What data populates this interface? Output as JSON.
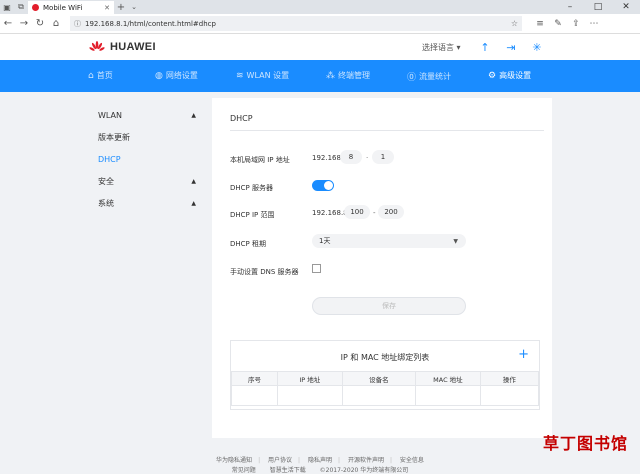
{
  "browser": {
    "tab_title": "Mobile WiFi",
    "url": "192.168.8.1/html/content.html#dhcp"
  },
  "header": {
    "brand": "HUAWEI",
    "language": "选择语言"
  },
  "main_nav": [
    {
      "label": "首页",
      "icon": "home-icon",
      "active": false
    },
    {
      "label": "网络设置",
      "icon": "globe-icon",
      "active": false
    },
    {
      "label": "WLAN 设置",
      "icon": "wifi-icon",
      "active": false
    },
    {
      "label": "终端管理",
      "icon": "devices-icon",
      "active": false
    },
    {
      "label": "流量统计",
      "icon": "traffic-icon",
      "active": false
    },
    {
      "label": "高级设置",
      "icon": "gear-icon",
      "active": true
    }
  ],
  "sidebar": [
    {
      "label": "WLAN",
      "caret": "▲"
    },
    {
      "label": "版本更新"
    },
    {
      "label": "DHCP",
      "active": true
    },
    {
      "label": "安全",
      "caret": "▲"
    },
    {
      "label": "系统",
      "caret": "▲"
    }
  ],
  "dhcp": {
    "section_title": "DHCP",
    "lan_ip_label": "本机局域网 IP 地址",
    "lan_ip_prefix": "192.168.",
    "lan_ip_octet3": "8",
    "lan_ip_octet4": "1",
    "server_label": "DHCP 服务器",
    "server_enabled": true,
    "range_label": "DHCP IP 范围",
    "range_prefix": "192.168.8.",
    "range_start": "100",
    "range_end": "200",
    "lease_label": "DHCP 租期",
    "lease_value": "1天",
    "dns_label": "手动设置 DNS 服务器",
    "dns_checked": false,
    "save_label": "保存",
    "range_dash": "-",
    "ip_dash": "·"
  },
  "binding": {
    "title": "IP 和 MAC 地址绑定列表",
    "columns": [
      "序号",
      "IP 地址",
      "设备名",
      "MAC 地址",
      "操作"
    ]
  },
  "footer": {
    "links": [
      "华为隐私通知",
      "用户协议",
      "隐私声明",
      "开源软件声明",
      "安全信息"
    ],
    "faq": "常见问题",
    "smart_home": "智慧生活下载",
    "copyright": "©2017-2020 华为终端有限公司"
  },
  "watermark": "草丁图书馆",
  "colors": {
    "accent": "#1a8cff",
    "brand_red": "#e21e2b"
  }
}
